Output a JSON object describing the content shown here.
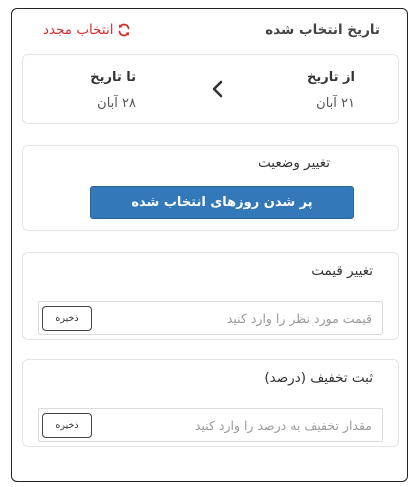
{
  "header": {
    "title": "تاریخ انتخاب شده",
    "reselect_label": "انتخاب مجدد",
    "reselect_icon": "refresh-icon",
    "reselect_color": "#d32f2f"
  },
  "dates": {
    "from_label": "از تاریخ",
    "from_value": "۲۱ آبان",
    "to_label": "تا تاریخ",
    "to_value": "۲۸ آبان",
    "arrow_icon": "chevron-left-icon"
  },
  "status": {
    "title": "تغییر وضعیت",
    "fill_button_label": "پر شدن روزهای انتخاب شده",
    "fill_button_color": "#3378b8"
  },
  "price": {
    "title": "تغییر قیمت",
    "placeholder": "قیمت مورد نظر را وارد کنید",
    "value": "",
    "save_label": "ذخیره"
  },
  "discount": {
    "title": "ثبت تخفیف (درصد)",
    "placeholder": "مقدار تخفیف به درصد را وارد کنید",
    "value": "",
    "save_label": "ذخیره"
  }
}
